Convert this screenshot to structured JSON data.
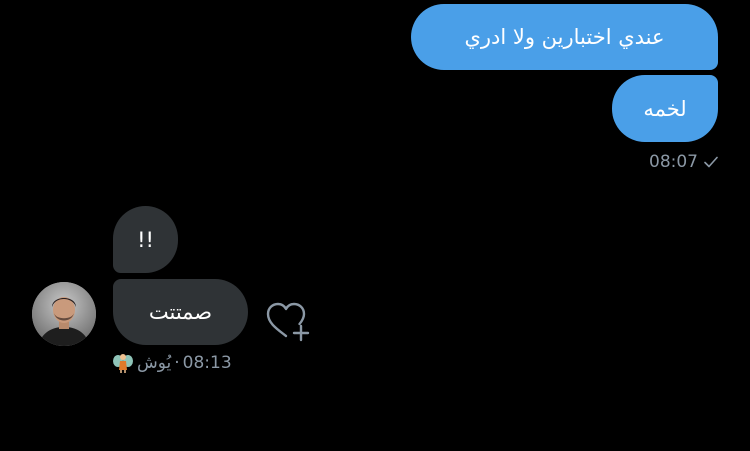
{
  "messages": {
    "outgoing": [
      {
        "text": "عندي اختبارين ولا ادري"
      },
      {
        "text": "لخمه"
      }
    ],
    "outgoing_time": "08:07",
    "incoming": [
      {
        "text": "!!"
      },
      {
        "text": "صمتتت"
      }
    ],
    "incoming_time": "08:13",
    "incoming_separator": "·",
    "incoming_sender": "يُوش"
  },
  "icons": {
    "sent": "checkmark-icon",
    "react": "heart-plus-icon",
    "sender_emoji": "fairy-emoji-icon"
  },
  "colors": {
    "outgoing_bubble": "#4a9fe8",
    "incoming_bubble": "#2f3336",
    "meta_text": "#8b98a5",
    "background": "#000000"
  }
}
